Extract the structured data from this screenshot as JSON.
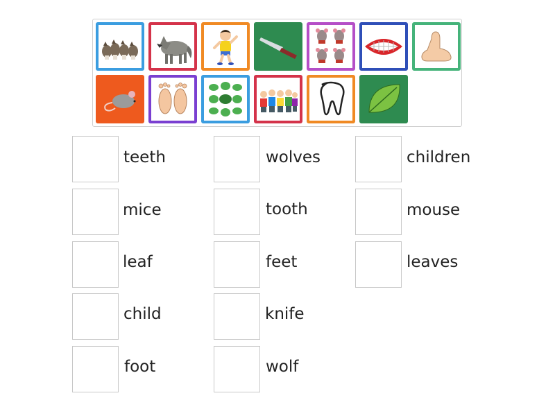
{
  "tiles": [
    {
      "icon": "wolves-group-icon",
      "color": "#3b9de0"
    },
    {
      "icon": "wolf-icon",
      "color": "#d4334a"
    },
    {
      "icon": "child-icon",
      "color": "#f08a24"
    },
    {
      "icon": "knife-icon",
      "color": "#2e8b50"
    },
    {
      "icon": "mice-icon",
      "color": "#b54fc7"
    },
    {
      "icon": "teeth-icon",
      "color": "#2f4fb8"
    },
    {
      "icon": "foot-icon",
      "color": "#45b37a"
    },
    {
      "icon": "mouse-icon",
      "color": "#ee5a1e"
    },
    {
      "icon": "feet-icon",
      "color": "#7a3fd1"
    },
    {
      "icon": "leaves-icon",
      "color": "#3b9de0"
    },
    {
      "icon": "children-icon",
      "color": "#d4334a"
    },
    {
      "icon": "tooth-icon",
      "color": "#f08a24"
    },
    {
      "icon": "leaf-icon",
      "color": "#2e8b50"
    }
  ],
  "words": [
    "teeth",
    "wolves",
    "children",
    "mice",
    "tooth",
    "mouse",
    "leaf",
    "feet",
    "leaves",
    "child",
    "knife",
    "foot",
    "wolf"
  ]
}
